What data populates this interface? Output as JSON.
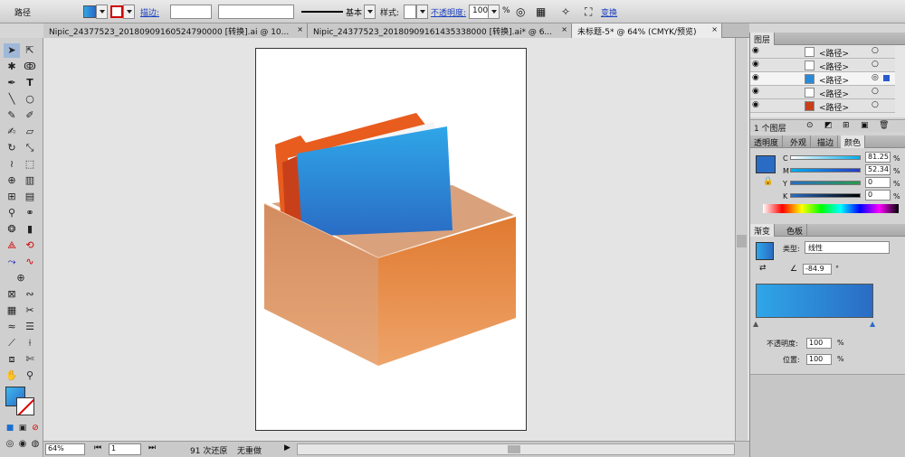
{
  "control_bar": {
    "object_type": "路径",
    "stroke_label": "描边:",
    "stroke_profile": "基本",
    "style_label": "样式:",
    "opacity_label": "不透明度:",
    "opacity_value": "100",
    "percent": "%",
    "transform_link": "变换"
  },
  "tabs": [
    {
      "label": "Nipic_24377523_20180909160524790000 [转换].ai @ 10..."
    },
    {
      "label": "Nipic_24377523_20180909161435338000 [转换].ai* @ 6..."
    },
    {
      "label": "未标题-5* @ 64% (CMYK/预览)"
    }
  ],
  "tab_close": "×",
  "status": {
    "zoom": "64%",
    "page": "1",
    "undo": "91 次还原",
    "redo": "无重做"
  },
  "layers_panel": {
    "title": "图层",
    "rows": [
      {
        "label": "<路径>"
      },
      {
        "label": "<路径>"
      },
      {
        "label": "<路径>"
      },
      {
        "label": "<路径>"
      },
      {
        "label": "<路径>"
      }
    ],
    "count": "1 个图层"
  },
  "color_panel": {
    "tabs": [
      "透明度",
      "外观",
      "描边",
      "颜色"
    ],
    "channels": [
      {
        "name": "C",
        "value": "81.25"
      },
      {
        "name": "M",
        "value": "52.34"
      },
      {
        "name": "Y",
        "value": "0"
      },
      {
        "name": "K",
        "value": "0"
      }
    ],
    "percent": "%"
  },
  "gradient_panel": {
    "tabs": [
      "渐变",
      "色板"
    ],
    "type_label": "类型:",
    "type_value": "线性",
    "angle": "-84.9",
    "degree": "°",
    "opacity_label": "不透明度:",
    "opacity_value": "100",
    "position_label": "位置:",
    "position_value": "100",
    "percent": "%"
  },
  "colors": {
    "gradient_start": "#2fa6e8",
    "gradient_end": "#2a6cc4",
    "box_front": "#e8873e",
    "box_side": "#d99a6c",
    "folder_orange": "#e85c1e"
  }
}
